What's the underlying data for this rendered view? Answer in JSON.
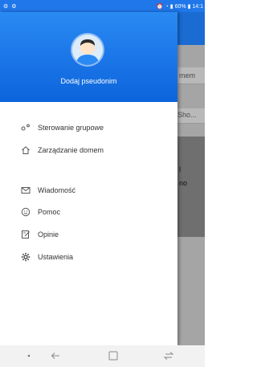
{
  "status": {
    "left_icons": [
      "settings-icon",
      "settings-icon"
    ],
    "right_text": "60%",
    "time": "14:1"
  },
  "background": {
    "strip1_text": "mem",
    "strip2_text": "Sho...",
    "dark_text_1": "l",
    "dark_text_2": "no"
  },
  "drawer": {
    "nickname": "Dodaj pseudonim",
    "items": [
      {
        "icon": "group-control-icon",
        "label": "Sterowanie grupowe"
      },
      {
        "icon": "home-icon",
        "label": "Zarządzanie domem"
      },
      {
        "icon": "mail-icon",
        "label": "Wiadomość"
      },
      {
        "icon": "help-icon",
        "label": "Pomoc"
      },
      {
        "icon": "feedback-icon",
        "label": "Opinie"
      },
      {
        "icon": "settings-icon",
        "label": "Ustawienia"
      }
    ]
  },
  "navbar": {
    "buttons": [
      "dot-icon",
      "back-icon",
      "overview-icon",
      "recents-icon"
    ]
  }
}
